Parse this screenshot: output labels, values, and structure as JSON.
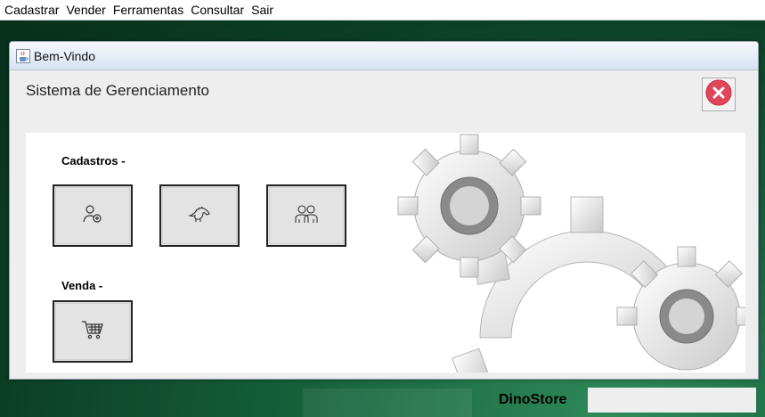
{
  "menubar": {
    "items": [
      "Cadastrar",
      "Vender",
      "Ferramentas",
      "Consultar",
      "Sair"
    ]
  },
  "window": {
    "title": "Bem-Vindo",
    "icon": "java-coffee-icon",
    "header": "Sistema de Gerenciamento",
    "close_icon": "close-circle-icon"
  },
  "sections": {
    "cadastros": {
      "label": "Cadastros -",
      "buttons": [
        {
          "icon": "add-user-icon"
        },
        {
          "icon": "dinosaur-icon"
        },
        {
          "icon": "team-icon"
        }
      ]
    },
    "venda": {
      "label": "Venda -",
      "buttons": [
        {
          "icon": "shopping-cart-icon"
        }
      ]
    }
  },
  "footer": {
    "brand": "DinoStore"
  },
  "colors": {
    "desktop": "#0b3f25",
    "close_red": "#e0455a",
    "tile_bg": "#e3e3e3"
  }
}
